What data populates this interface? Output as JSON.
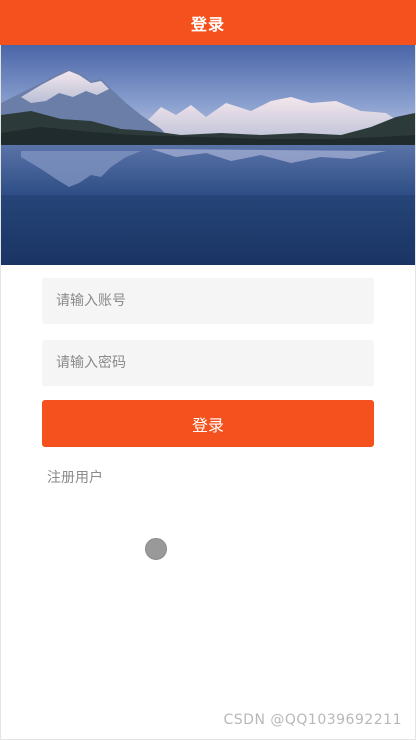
{
  "header": {
    "title": "登录",
    "color": "#f4511e"
  },
  "banner": {
    "description_icon": "mountain-lake-image"
  },
  "form": {
    "account_placeholder": "请输入账号",
    "password_placeholder": "请输入密码",
    "account_value": "",
    "password_value": "",
    "login_label": "登录",
    "register_label": "注册用户"
  },
  "watermark": {
    "text": "CSDN @QQ1039692211"
  }
}
